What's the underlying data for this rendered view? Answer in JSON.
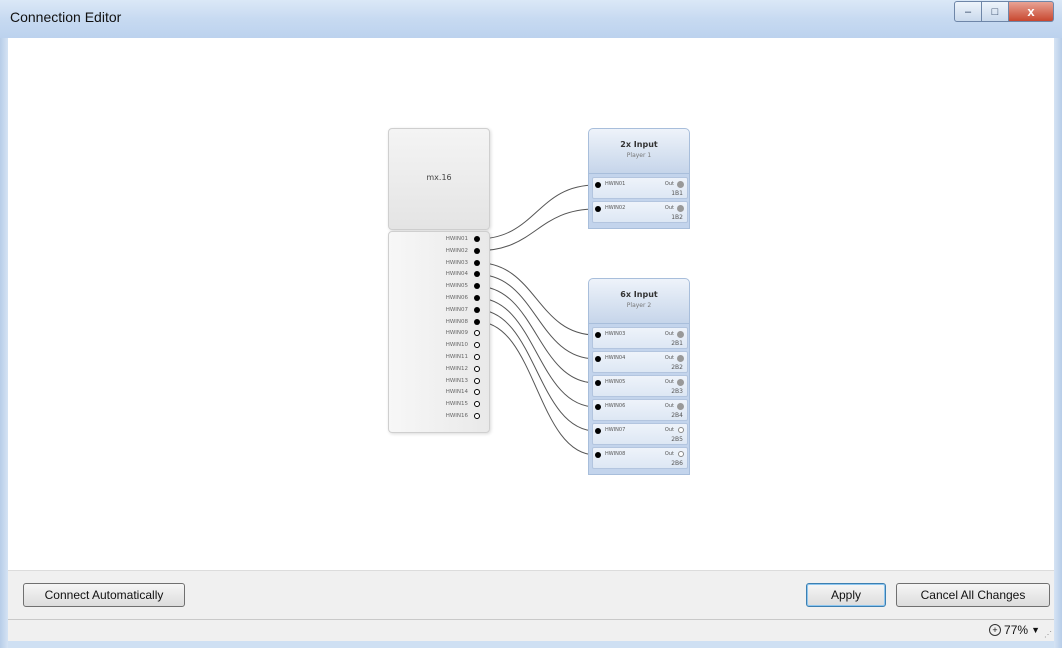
{
  "window": {
    "title": "Connection Editor",
    "controls": {
      "minimize": "–",
      "maximize": "□",
      "close": "x"
    }
  },
  "source_node": {
    "title": "mx.16",
    "pins": [
      {
        "label": "HWIN01",
        "connected": true
      },
      {
        "label": "HWIN02",
        "connected": true
      },
      {
        "label": "HWIN03",
        "connected": true
      },
      {
        "label": "HWIN04",
        "connected": true
      },
      {
        "label": "HWIN05",
        "connected": true
      },
      {
        "label": "HWIN06",
        "connected": true
      },
      {
        "label": "HWIN07",
        "connected": true
      },
      {
        "label": "HWIN08",
        "connected": true
      },
      {
        "label": "HWIN09",
        "connected": false
      },
      {
        "label": "HWIN10",
        "connected": false
      },
      {
        "label": "HWIN11",
        "connected": false
      },
      {
        "label": "HWIN12",
        "connected": false
      },
      {
        "label": "HWIN13",
        "connected": false
      },
      {
        "label": "HWIN14",
        "connected": false
      },
      {
        "label": "HWIN15",
        "connected": false
      },
      {
        "label": "HWIN16",
        "connected": false
      }
    ]
  },
  "players": [
    {
      "title": "2x Input",
      "subtitle": "Player 1",
      "slots": [
        {
          "in_label": "HWIN01",
          "out_label": "Out",
          "number": "1B1",
          "out_connected": true
        },
        {
          "in_label": "HWIN02",
          "out_label": "Out",
          "number": "1B2",
          "out_connected": true
        }
      ]
    },
    {
      "title": "6x Input",
      "subtitle": "Player 2",
      "slots": [
        {
          "in_label": "HWIN03",
          "out_label": "Out",
          "number": "2B1",
          "out_connected": true
        },
        {
          "in_label": "HWIN04",
          "out_label": "Out",
          "number": "2B2",
          "out_connected": true
        },
        {
          "in_label": "HWIN05",
          "out_label": "Out",
          "number": "2B3",
          "out_connected": true
        },
        {
          "in_label": "HWIN06",
          "out_label": "Out",
          "number": "2B4",
          "out_connected": true
        },
        {
          "in_label": "HWIN07",
          "out_label": "Out",
          "number": "2B5",
          "out_connected": false
        },
        {
          "in_label": "HWIN08",
          "out_label": "Out",
          "number": "2B6",
          "out_connected": false
        }
      ]
    }
  ],
  "buttons": {
    "connect_automatically": "Connect Automatically",
    "apply": "Apply",
    "cancel_all_changes": "Cancel All Changes"
  },
  "status": {
    "zoom": "77%",
    "zoom_icon": "zoom-in-icon"
  },
  "colors": {
    "titlebar": "#c7daf1",
    "player_accent": "#c3d4ec",
    "close_button": "#c8472f"
  }
}
